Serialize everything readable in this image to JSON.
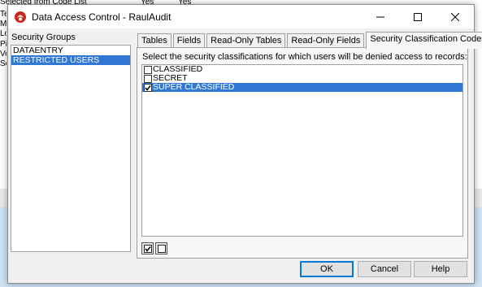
{
  "background": {
    "row1_label": "Selected from Code List",
    "row1_val1": "Yes",
    "row1_val2": "Yes",
    "left_letters": [
      "Te",
      "M",
      "Lo",
      "Pi",
      "Ve",
      "Se"
    ]
  },
  "window": {
    "title": "Data Access Control - RaulAudit",
    "icon": "app-logo-icon",
    "controls": [
      "minimize-icon",
      "maximize-icon",
      "close-icon"
    ]
  },
  "groups": {
    "label": "Security Groups",
    "items": [
      {
        "label": "DATAENTRY",
        "selected": false
      },
      {
        "label": "RESTRICTED USERS",
        "selected": true
      }
    ]
  },
  "tabs": [
    {
      "label": "Tables",
      "active": false
    },
    {
      "label": "Fields",
      "active": false
    },
    {
      "label": "Read-Only Tables",
      "active": false
    },
    {
      "label": "Read-Only Fields",
      "active": false
    },
    {
      "label": "Security Classification Codes",
      "active": true
    }
  ],
  "panel": {
    "description": "Select the security classifications for which users will be denied access to records:",
    "codes": [
      {
        "label": "CLASSIFIED",
        "checked": false,
        "selected": false
      },
      {
        "label": "SECRET",
        "checked": false,
        "selected": false
      },
      {
        "label": "SUPER CLASSIFIED",
        "checked": true,
        "selected": true
      }
    ],
    "check_all_icon": "check-all-icon",
    "uncheck_all_icon": "uncheck-all-icon"
  },
  "buttons": {
    "ok": "OK",
    "cancel": "Cancel",
    "help": "Help"
  },
  "colors": {
    "selection": "#3178d4",
    "dialog_bg": "#f0f0f0",
    "default_button_border": "#0078d7"
  }
}
